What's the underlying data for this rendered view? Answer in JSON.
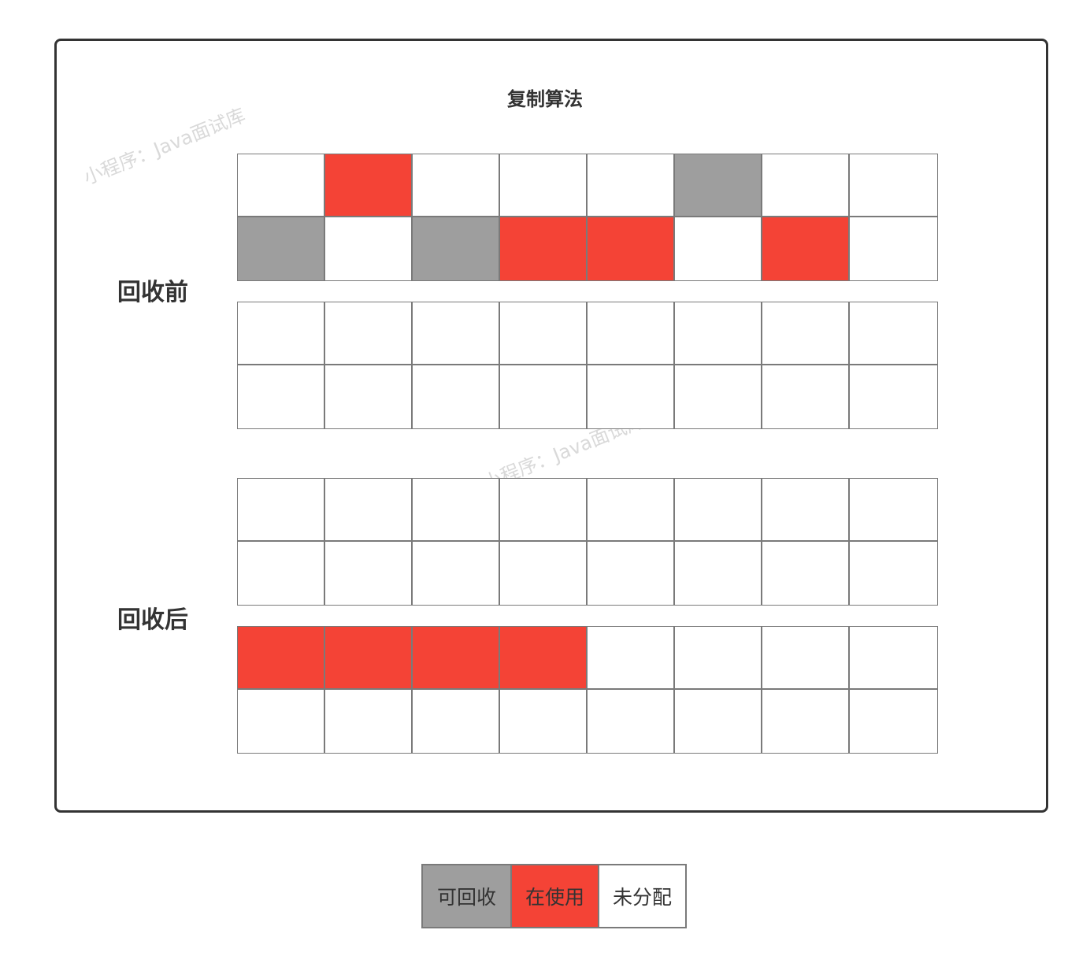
{
  "title": "复制算法",
  "watermark": "小程序：Java面试库",
  "colors": {
    "recyclable": "#9e9e9e",
    "in_use": "#f44336",
    "unallocated": "#ffffff",
    "border": "#7a7a7a"
  },
  "before": {
    "label": "回收前",
    "from_space": [
      "free",
      "used",
      "free",
      "free",
      "free",
      "recyclable",
      "free",
      "free",
      "recyclable",
      "free",
      "recyclable",
      "used",
      "used",
      "free",
      "used",
      "free"
    ],
    "to_space": [
      "free",
      "free",
      "free",
      "free",
      "free",
      "free",
      "free",
      "free",
      "free",
      "free",
      "free",
      "free",
      "free",
      "free",
      "free",
      "free"
    ]
  },
  "after": {
    "label": "回收后",
    "from_space": [
      "free",
      "free",
      "free",
      "free",
      "free",
      "free",
      "free",
      "free",
      "free",
      "free",
      "free",
      "free",
      "free",
      "free",
      "free",
      "free"
    ],
    "to_space": [
      "used",
      "used",
      "used",
      "used",
      "free",
      "free",
      "free",
      "free",
      "free",
      "free",
      "free",
      "free",
      "free",
      "free",
      "free",
      "free"
    ]
  },
  "legend": [
    {
      "key": "recyclable",
      "label": "可回收"
    },
    {
      "key": "used",
      "label": "在使用"
    },
    {
      "key": "free",
      "label": "未分配"
    }
  ]
}
